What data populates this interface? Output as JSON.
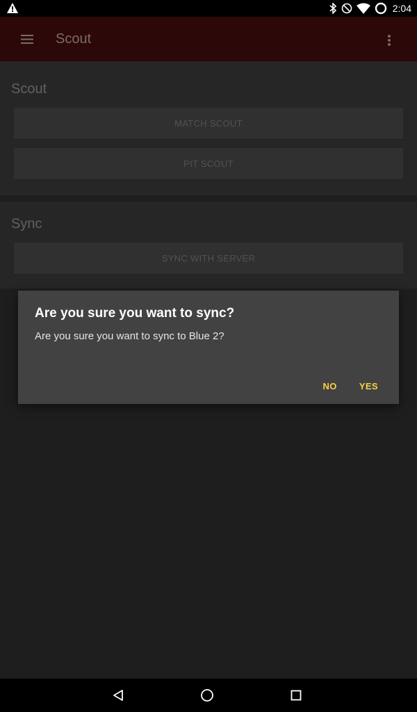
{
  "status_bar": {
    "time": "2:04",
    "icons": [
      "warning-icon",
      "bluetooth-icon",
      "do-not-disturb-icon",
      "wifi-icon",
      "battery-icon"
    ]
  },
  "app_bar": {
    "title": "Scout",
    "menu_icon": "hamburger-menu-icon",
    "overflow_icon": "more-vert-icon",
    "background_color": "#2d0809"
  },
  "sections": {
    "scout": {
      "title": "Scout",
      "buttons": [
        "MATCH SCOUT",
        "PIT SCOUT"
      ]
    },
    "sync": {
      "title": "Sync",
      "buttons": [
        "SYNC WITH SERVER"
      ]
    }
  },
  "dialog": {
    "title": "Are you sure you want to sync?",
    "message": "Are you sure you want to sync to Blue 2?",
    "negative_label": "NO",
    "positive_label": "YES",
    "accent_color": "#f7d343"
  },
  "nav_bar": {
    "icons": [
      "back-icon",
      "home-icon",
      "recents-icon"
    ]
  }
}
